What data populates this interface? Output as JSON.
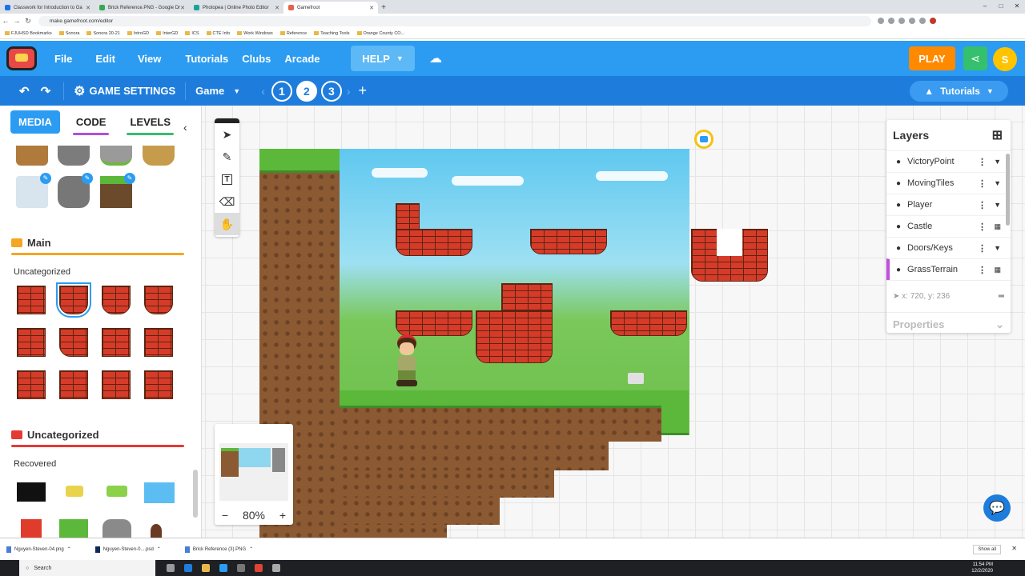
{
  "browser": {
    "tabs": [
      {
        "title": "Classwork for Introduction to Ga",
        "color": "#1a73e8"
      },
      {
        "title": "Brick Reference.PNG - Google Dr",
        "color": "#34a853"
      },
      {
        "title": "Photopea | Online Photo Editor",
        "color": "#18a497"
      },
      {
        "title": "Gamefroot",
        "color": "#e8614d"
      }
    ],
    "url": "make.gamefroot.com/editor",
    "bookmarks": [
      "FJUHSD Bookmarks",
      "Sonora",
      "Sonora 20-21",
      "IntroGD",
      "InterGD",
      "ICS",
      "CTE Info",
      "Work Windows",
      "Reference",
      "Teaching Tools",
      "Orange County CO..."
    ]
  },
  "topnav": {
    "file": "File",
    "edit": "Edit",
    "view": "View",
    "tutorials": "Tutorials",
    "clubs": "Clubs",
    "arcade": "Arcade",
    "help": "HELP",
    "play": "PLAY",
    "avatar_initial": "S"
  },
  "secbar": {
    "game_settings": "GAME SETTINGS",
    "scene": "Game",
    "levels": [
      "1",
      "2",
      "3"
    ],
    "tutorials": "Tutorials"
  },
  "leftpanel": {
    "tabs": {
      "media": "MEDIA",
      "code": "CODE",
      "levels": "LEVELS"
    },
    "main_folder": "Main",
    "uncategorized_sub": "Uncategorized",
    "uncategorized_folder": "Uncategorized",
    "recovered_sub": "Recovered",
    "colors": {
      "main": "#f5a623",
      "uncategorized": "#e53935"
    }
  },
  "editor": {
    "zoom": "80%",
    "layers_title": "Layers",
    "layers": [
      "VictoryPoint",
      "MovingTiles",
      "Player",
      "Castle",
      "Doors/Keys",
      "GrassTerrain"
    ],
    "coords": "x: 720, y: 236",
    "properties": "Properties"
  },
  "downloads": {
    "files": [
      "Nguyen-Steven-04.png",
      "Nguyen-Steven-0....psd",
      "Brick Reference (3).PNG"
    ],
    "show_all": "Show all"
  },
  "taskbar": {
    "search": "Search",
    "time": "11:54 PM",
    "date": "12/2/2020"
  }
}
